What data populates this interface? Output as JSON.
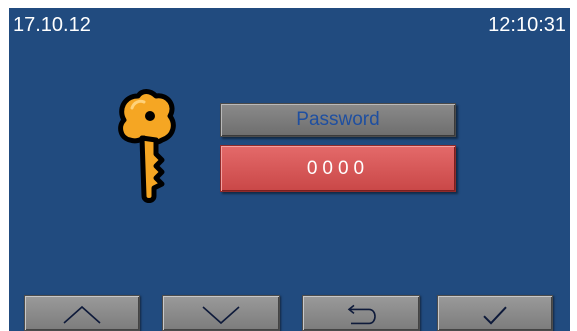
{
  "header": {
    "date": "17.10.12",
    "time": "12:10:31"
  },
  "login": {
    "icon": "key-icon",
    "password_label": "Password",
    "password_value": "0000"
  },
  "softkeys": [
    {
      "icon": "chevron-up-icon"
    },
    {
      "icon": "chevron-down-icon"
    },
    {
      "icon": "return-icon"
    },
    {
      "icon": "checkmark-icon"
    }
  ],
  "colors": {
    "background": "#214b7f",
    "field_active": "#d85555",
    "button_gray": "#8a8a8a",
    "label_text": "#1f4fa0",
    "key_gold": "#f5a623"
  }
}
